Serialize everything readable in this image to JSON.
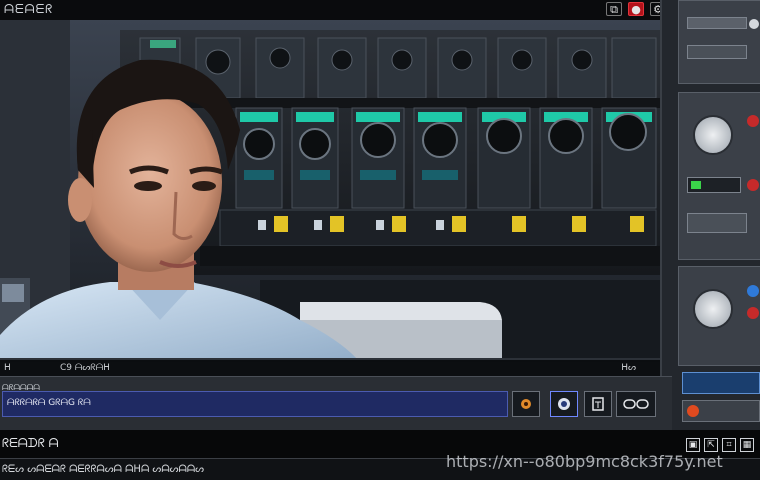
{
  "header": {
    "title": "ᗩᗴᗩᗴᖇ",
    "icons": [
      "copy-icon",
      "record-icon",
      "settings-icon",
      "pin-icon",
      "grid-icon",
      "square-icon",
      "gear-icon"
    ]
  },
  "viewport": {
    "status_left": "ᕼ",
    "status_mid": "C9  ᗩᔕᖇᗩᕼ",
    "status_right": "ᕼᔕ"
  },
  "controls": {
    "label": "ᗩᖇᗩᗩᗩᗩ",
    "track_text": "ᗩᖇᖇᗩᖇᗩ  GᖇᗩG ᖇᗩ",
    "buttons": [
      "record-button",
      "play-button",
      "edit-button",
      "link-button"
    ]
  },
  "footer": {
    "line1": "ᖇᗴᗩᗪᖇ ᗩ",
    "line2": "ᖇᗴᔕ ᔕᗩᗴᗩᖇ ᗩᗴᖇᖇᗩᔕᗩ  ᗩᕼᗩ ᔕᗩᔕᗩᗩᔕ",
    "watermark": "https://xn--o80bp9mc8ck3f75y.net"
  },
  "colors": {
    "accent_blue": "#1f2a63",
    "record_red": "#b3121a",
    "rack_teal": "#1fc9a8",
    "shirt": "#b9cfe6"
  }
}
